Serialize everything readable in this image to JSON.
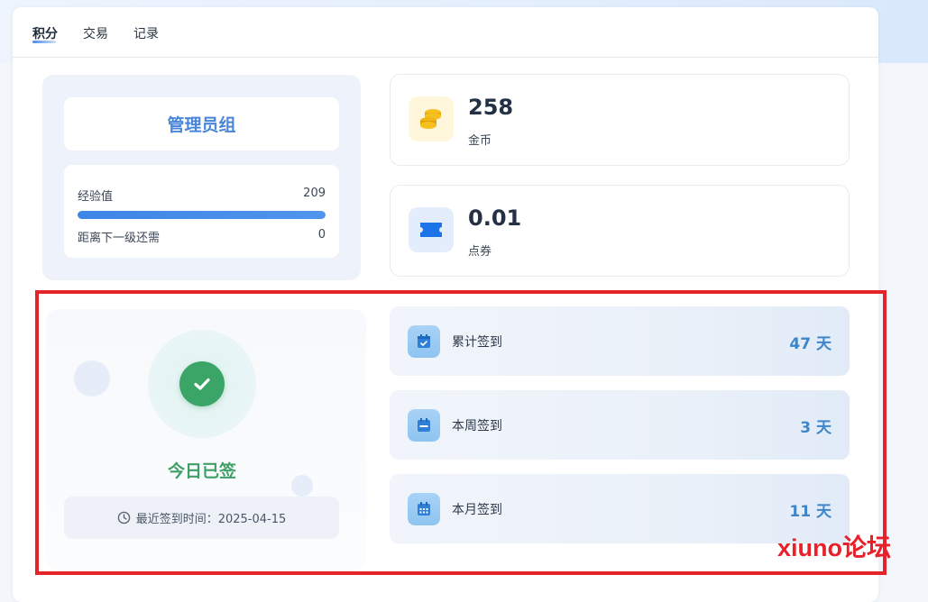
{
  "tabs": [
    {
      "label": "积分",
      "active": true
    },
    {
      "label": "交易",
      "active": false
    },
    {
      "label": "记录",
      "active": false
    }
  ],
  "group": {
    "title": "管理员组",
    "exp_label": "经验值",
    "exp_value": "209",
    "exp_progress_percent": 100,
    "next_label": "距离下一级还需",
    "next_value": "0"
  },
  "stats": [
    {
      "value": "258",
      "label": "金币",
      "icon": "coins-icon",
      "color": "#f4c21f"
    },
    {
      "value": "0.01",
      "label": "点券",
      "icon": "ticket-icon",
      "color": "#1d74e8"
    }
  ],
  "checkin": {
    "status": "今日已签",
    "last_time": "最近签到时间：2025-04-15"
  },
  "checkin_stats": [
    {
      "label": "累计签到",
      "value": "47 天",
      "icon": "calendar-check-icon"
    },
    {
      "label": "本周签到",
      "value": "3 天",
      "icon": "calendar-week-icon"
    },
    {
      "label": "本月签到",
      "value": "11 天",
      "icon": "calendar-month-icon"
    }
  ],
  "watermark": "xiuno论坛",
  "colors": {
    "accent": "#4a86d8",
    "success": "#3aa566",
    "highlight": "#e3242b"
  }
}
